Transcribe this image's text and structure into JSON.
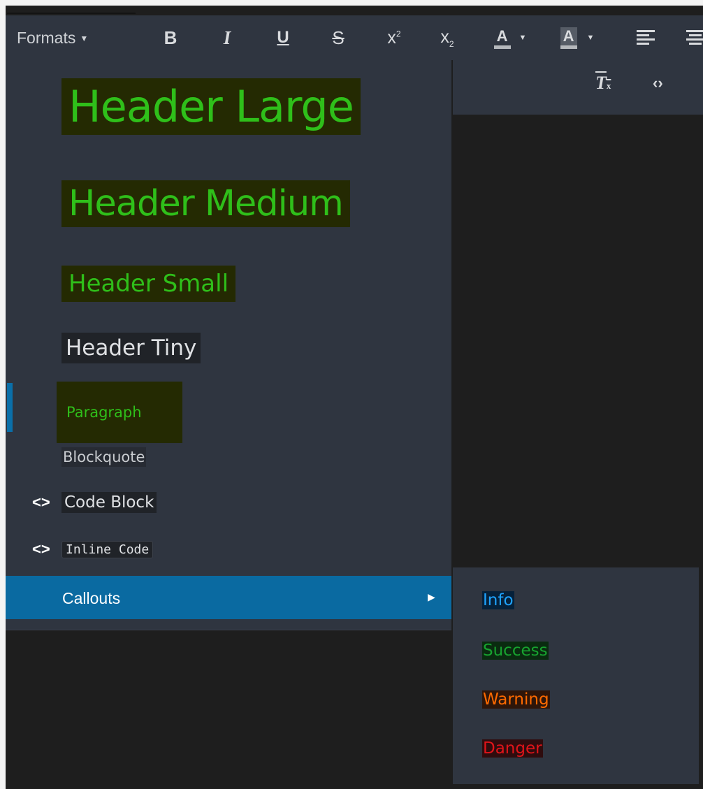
{
  "toolbar": {
    "formats_label": "Formats",
    "buttons": [
      {
        "name": "bold",
        "glyph": "B"
      },
      {
        "name": "italic",
        "glyph": "I"
      },
      {
        "name": "underline",
        "glyph": "U"
      },
      {
        "name": "strikethrough",
        "glyph": "S"
      },
      {
        "name": "superscript",
        "glyph": "x²"
      },
      {
        "name": "subscript",
        "glyph": "x₂"
      },
      {
        "name": "text-color",
        "glyph": "A"
      },
      {
        "name": "background-color",
        "glyph": "A"
      }
    ],
    "row2_icons": [
      "remove-format-icon",
      "source-code-icon"
    ]
  },
  "formats_menu": {
    "items": {
      "header_large": "Header Large",
      "header_medium": "Header Medium",
      "header_small": "Header Small",
      "header_tiny": "Header Tiny",
      "paragraph": "Paragraph",
      "blockquote": "Blockquote",
      "code_block": "Code Block",
      "inline_code": "Inline Code",
      "callouts": "Callouts"
    },
    "selected_item": "Paragraph",
    "active_item": "Callouts"
  },
  "callouts_submenu": {
    "items": {
      "info": "Info",
      "success": "Success",
      "warning": "Warning",
      "danger": "Danger"
    }
  },
  "colors": {
    "menu_bg": "#2f3540",
    "active_bg": "#0a6aa1",
    "header_green": "#2fbf1a",
    "info": "#1fa3ff",
    "success": "#17a32f",
    "warning": "#ff6a00",
    "danger": "#e0141a"
  }
}
